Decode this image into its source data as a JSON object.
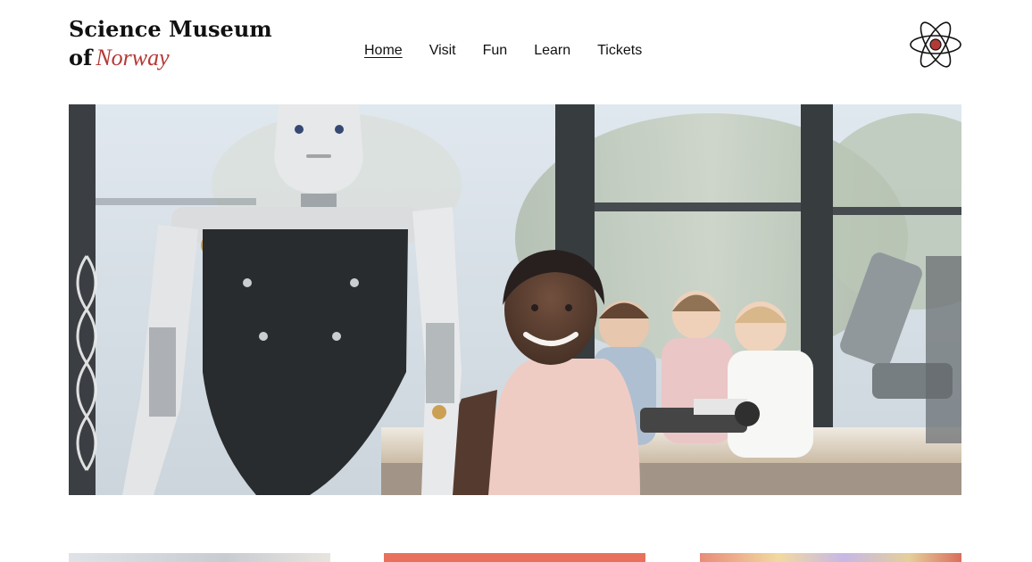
{
  "brand": {
    "line1": "Science Museum",
    "line2_prefix": "of",
    "line2_accent": "Norway",
    "accent_color": "#b43a36"
  },
  "nav": {
    "items": [
      {
        "label": "Home",
        "active": true
      },
      {
        "label": "Visit",
        "active": false
      },
      {
        "label": "Fun",
        "active": false
      },
      {
        "label": "Learn",
        "active": false
      },
      {
        "label": "Tickets",
        "active": false
      }
    ]
  },
  "icons": {
    "logo_icon": "atom-icon"
  },
  "hero": {
    "image": "robot-with-children-in-lab"
  },
  "cards": [
    {
      "image": "geometric-pattern-thumbnail"
    },
    {
      "image": "coral-colored-thumbnail"
    },
    {
      "image": "colorful-crafts-thumbnail"
    }
  ]
}
